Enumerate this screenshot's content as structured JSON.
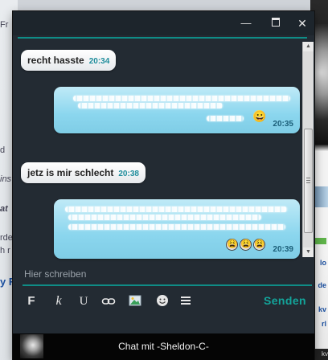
{
  "background": {
    "left_fragments": [
      "Fr",
      "d",
      "ins",
      "at",
      "rde",
      "h r",
      "y R"
    ],
    "right_fragments": [
      "lo",
      "de",
      "kv",
      "rl",
      "kv"
    ]
  },
  "window": {
    "min_symbol": "—",
    "close_symbol": "✕"
  },
  "messages": [
    {
      "text": "recht hasste",
      "time": "20:34",
      "direction": "in"
    },
    {
      "text": "",
      "time": "20:35",
      "direction": "out",
      "emojis": [
        "😀"
      ]
    },
    {
      "text": "jetz is mir schlecht",
      "time": "20:38",
      "direction": "in"
    },
    {
      "text": "",
      "time": "20:39",
      "direction": "out",
      "emojis": [
        "😩",
        "😩",
        "😩"
      ]
    }
  ],
  "input": {
    "placeholder": "Hier schreiben",
    "value": ""
  },
  "toolbar": {
    "bold": "F",
    "italic": "k",
    "underline": "U",
    "icons": [
      "link-icon",
      "image-icon",
      "smiley-icon",
      "list-icon"
    ]
  },
  "send_label": "Senden",
  "footer": {
    "title": "Chat mit -Sheldon-C-"
  },
  "colors": {
    "accent": "#0f8c86",
    "send": "#13a59b",
    "timestamp": "#1f8d9c",
    "window_bg": "#232b33",
    "out_bubble": "#8bd6ee"
  }
}
